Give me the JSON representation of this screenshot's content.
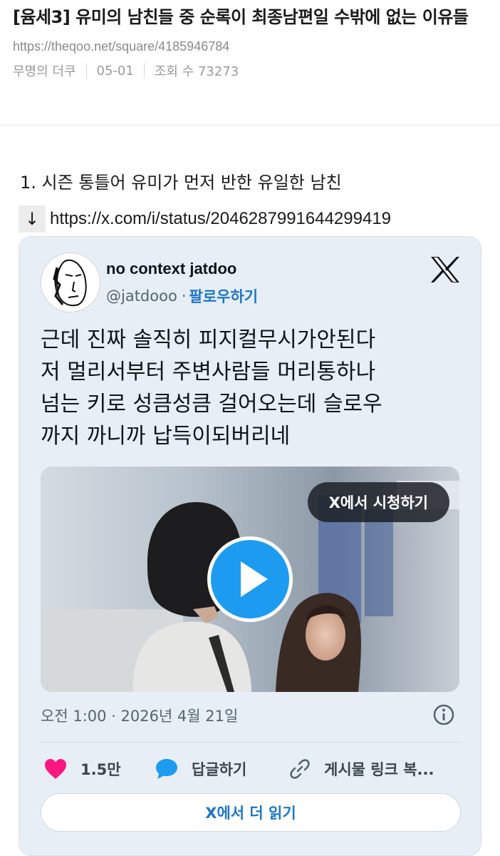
{
  "post": {
    "title": "[윰세3] 유미의 남친들 중 순록이 최종남편일 수밖에 없는 이유들",
    "url": "https://theqoo.net/square/4185946784",
    "author": "무명의 더쿠",
    "date": "05-01",
    "views": "조회 수 73273"
  },
  "content": {
    "section_heading": "1. 시즌 통틀어 유미가 먼저 반한 유일한 남친",
    "arrow": "↓",
    "link": "https://x.com/i/status/2046287991644299419"
  },
  "tweet": {
    "display_name": "no context jatdoo",
    "handle": "@jatdooo",
    "dot": "·",
    "follow_label": "팔로우하기",
    "text_lines": [
      "근데 진짜 솔직히 피지컬무시가안된다",
      "저 멀리서부터 주변사람들 머리통하나",
      "넘는 키로 성큼성큼 걸어오는데 슬로우",
      "까지 까니까 납득이되버리네"
    ],
    "watch_label": "X에서 시청하기",
    "timestamp": "오전 1:00 · 2026년 4월 21일",
    "like_count": "1.5만",
    "reply_label": "답글하기",
    "copy_label": "게시물 링크 복...",
    "read_more_label": "X에서 더 읽기",
    "icons": {
      "like": "heart-icon",
      "reply": "reply-bubble-icon",
      "copy": "link-icon",
      "info": "info-icon",
      "logo": "x-logo-icon",
      "play": "play-icon"
    },
    "colors": {
      "accent": "#1d9bf0",
      "link": "#1d76c8",
      "like": "#f91880",
      "card_bg": "#e8eef5"
    }
  }
}
